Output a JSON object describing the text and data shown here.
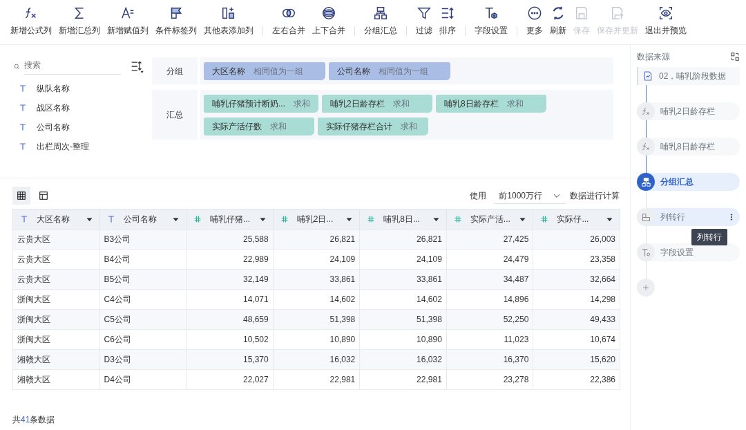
{
  "toolbar": {
    "groups": [
      {
        "items": [
          {
            "label": "新增公式列",
            "disabled": false
          },
          {
            "label": "新增汇总列",
            "disabled": false
          },
          {
            "label": "新增赋值列",
            "disabled": false
          },
          {
            "label": "条件标签列",
            "disabled": false
          },
          {
            "label": "其他表添加列",
            "disabled": false
          }
        ]
      },
      {
        "items": [
          {
            "label": "左右合并",
            "disabled": false
          },
          {
            "label": "上下合并",
            "disabled": false
          }
        ]
      },
      {
        "items": [
          {
            "label": "分组汇总",
            "disabled": false
          }
        ]
      },
      {
        "items": [
          {
            "label": "过滤",
            "disabled": false
          },
          {
            "label": "排序",
            "disabled": false
          }
        ]
      },
      {
        "items": [
          {
            "label": "字段设置",
            "disabled": false
          }
        ]
      },
      {
        "items": [
          {
            "label": "更多",
            "disabled": false
          },
          {
            "label": "刷新",
            "disabled": false
          },
          {
            "label": "保存",
            "disabled": true
          },
          {
            "label": "保存并更新",
            "disabled": true
          },
          {
            "label": "退出并预览",
            "disabled": false
          }
        ]
      }
    ]
  },
  "field_list": {
    "search": {
      "placeholder": "搜索"
    },
    "fields": [
      {
        "name": "纵队名称"
      },
      {
        "name": "战区名称"
      },
      {
        "name": "公司名称"
      },
      {
        "name": "出栏周次-整理"
      }
    ]
  },
  "config": [
    {
      "kind": "group",
      "label": "分组",
      "chips": [
        {
          "name": "大区名称",
          "mode": "相同值为一组"
        },
        {
          "name": "公司名称",
          "mode": "相同值为一组"
        }
      ]
    },
    {
      "kind": "summary",
      "label": "汇总",
      "chips": [
        {
          "name": "哺乳仔猪预计断奶...",
          "mode": "求和"
        },
        {
          "name": "哺乳2日龄存栏",
          "mode": "求和"
        },
        {
          "name": "哺乳8日龄存栏",
          "mode": "求和"
        },
        {
          "name": "实际产活仔数",
          "mode": "求和"
        },
        {
          "name": "实际仔猪存栏合计",
          "mode": "求和"
        }
      ]
    }
  ],
  "view_toggle": [
    {
      "selected": true
    },
    {
      "selected": false
    }
  ],
  "data_range": {
    "prefix": "使用",
    "value": "前1000万行",
    "suffix": "数据进行计算"
  },
  "table": {
    "columns": [
      {
        "kind": "text",
        "name": "大区名称"
      },
      {
        "kind": "text",
        "name": "公司名称"
      },
      {
        "kind": "number",
        "name": "哺乳仔猪..."
      },
      {
        "kind": "number",
        "name": "哺乳2日..."
      },
      {
        "kind": "number",
        "name": "哺乳8日..."
      },
      {
        "kind": "number",
        "name": "实际产活..."
      },
      {
        "kind": "number",
        "name": "实际仔..."
      }
    ],
    "rows": [
      [
        "云贵大区",
        "B3公司",
        "25,588",
        "26,821",
        "26,821",
        "27,425",
        "26,003"
      ],
      [
        "云贵大区",
        "B4公司",
        "22,989",
        "24,109",
        "24,109",
        "24,479",
        "23,358"
      ],
      [
        "云贵大区",
        "B5公司",
        "32,149",
        "33,861",
        "33,861",
        "34,487",
        "32,664"
      ],
      [
        "浙闽大区",
        "C4公司",
        "14,071",
        "14,602",
        "14,602",
        "14,896",
        "14,298"
      ],
      [
        "浙闽大区",
        "C5公司",
        "48,659",
        "51,398",
        "51,398",
        "52,250",
        "49,433"
      ],
      [
        "浙闽大区",
        "C6公司",
        "10,502",
        "10,890",
        "10,890",
        "11,023",
        "10,674"
      ],
      [
        "湘赣大区",
        "D3公司",
        "15,370",
        "16,032",
        "16,032",
        "16,370",
        "15,620"
      ],
      [
        "湘赣大区",
        "D4公司",
        "22,027",
        "22,981",
        "22,981",
        "23,278",
        "22,386"
      ]
    ]
  },
  "footer": {
    "prefix": "共",
    "count": "41",
    "suffix": "条数据"
  },
  "steps_panel": {
    "title": "数据来源",
    "steps": [
      {
        "kind": "source",
        "label": "02，哺乳阶段数据",
        "selected": false,
        "hovered": false
      },
      {
        "kind": "formula",
        "label": "哺乳2日龄存栏",
        "selected": false,
        "hovered": false
      },
      {
        "kind": "formula",
        "label": "哺乳8日龄存栏",
        "selected": false,
        "hovered": false
      },
      {
        "kind": "group",
        "label": "分组汇总",
        "selected": true,
        "hovered": false
      },
      {
        "kind": "pivot",
        "label": "列转行",
        "selected": false,
        "hovered": true
      },
      {
        "kind": "fields",
        "label": "字段设置",
        "selected": false,
        "hovered": false
      }
    ],
    "tooltip": "列转行"
  }
}
